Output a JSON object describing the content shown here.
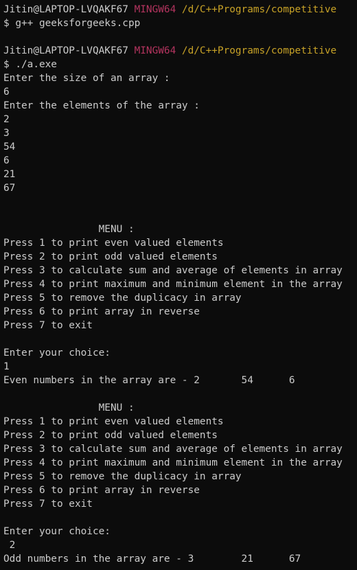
{
  "colors": {
    "background": "#0c0c0c",
    "default_text": "#cccccc",
    "user_host": "#cccccc",
    "mingw": "#b4345f",
    "path": "#c7a227"
  },
  "terminal": {
    "lines": [
      [
        {
          "text": "Jitin@LAPTOP-LVQAKF67 ",
          "color": "#cccccc"
        },
        {
          "text": "MINGW64 ",
          "color": "#b4345f"
        },
        {
          "text": "/d/C++Programs/competitive",
          "color": "#c7a227"
        }
      ],
      [
        {
          "text": "$ g++ geeksforgeeks.cpp"
        }
      ],
      [
        {
          "text": ""
        }
      ],
      [
        {
          "text": "Jitin@LAPTOP-LVQAKF67 ",
          "color": "#cccccc"
        },
        {
          "text": "MINGW64 ",
          "color": "#b4345f"
        },
        {
          "text": "/d/C++Programs/competitive",
          "color": "#c7a227"
        }
      ],
      [
        {
          "text": "$ ./a.exe"
        }
      ],
      [
        {
          "text": "Enter the size of an array :"
        }
      ],
      [
        {
          "text": "6"
        }
      ],
      [
        {
          "text": "Enter the elements of the array :"
        }
      ],
      [
        {
          "text": "2"
        }
      ],
      [
        {
          "text": "3"
        }
      ],
      [
        {
          "text": "54"
        }
      ],
      [
        {
          "text": "6"
        }
      ],
      [
        {
          "text": "21"
        }
      ],
      [
        {
          "text": "67"
        }
      ],
      [
        {
          "text": ""
        }
      ],
      [
        {
          "text": ""
        }
      ],
      [
        {
          "text": "                MENU :"
        }
      ],
      [
        {
          "text": "Press 1 to print even valued elements"
        }
      ],
      [
        {
          "text": "Press 2 to print odd valued elements"
        }
      ],
      [
        {
          "text": "Press 3 to calculate sum and average of elements in array"
        }
      ],
      [
        {
          "text": "Press 4 to print maximum and minimum element in the array"
        }
      ],
      [
        {
          "text": "Press 5 to remove the duplicacy in array"
        }
      ],
      [
        {
          "text": "Press 6 to print array in reverse"
        }
      ],
      [
        {
          "text": "Press 7 to exit"
        }
      ],
      [
        {
          "text": ""
        }
      ],
      [
        {
          "text": "Enter your choice:"
        }
      ],
      [
        {
          "text": "1"
        }
      ],
      [
        {
          "text": "Even numbers in the array are - 2       54      6"
        }
      ],
      [
        {
          "text": ""
        }
      ],
      [
        {
          "text": "                MENU :"
        }
      ],
      [
        {
          "text": "Press 1 to print even valued elements"
        }
      ],
      [
        {
          "text": "Press 2 to print odd valued elements"
        }
      ],
      [
        {
          "text": "Press 3 to calculate sum and average of elements in array"
        }
      ],
      [
        {
          "text": "Press 4 to print maximum and minimum element in the array"
        }
      ],
      [
        {
          "text": "Press 5 to remove the duplicacy in array"
        }
      ],
      [
        {
          "text": "Press 6 to print array in reverse"
        }
      ],
      [
        {
          "text": "Press 7 to exit"
        }
      ],
      [
        {
          "text": ""
        }
      ],
      [
        {
          "text": "Enter your choice:"
        }
      ],
      [
        {
          "text": " 2"
        }
      ],
      [
        {
          "text": "Odd numbers in the array are - 3        21      67"
        }
      ]
    ]
  }
}
